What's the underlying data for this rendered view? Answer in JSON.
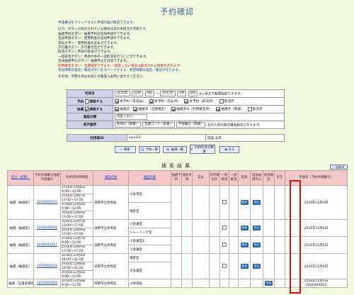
{
  "page": {
    "title": "予約確認"
  },
  "notice": {
    "lead": "申請番号をクリックすると申請内容が確認できます。",
    "lines": [
      "以下、ボタンが表示されている場合は次の手続きが可能です。",
      "抽選予約ボタン：抽選予約の追加申請ができます。",
      "追加申請ボタン：使用料金の追加申請ができます。",
      "支払ボタン：使用料金の支払ができます。",
      "許可書ボタン：許可書が出力できます。",
      "取消ボタン：申請の取消ができます。",
      "一括取消ボタン：申請の中の一括取消を行うことができます。",
      "追加抽選申込ボタン：抽選申込を追加できます。",
      "利用確定ボタン：当選確定できます。（確定しない場合は取消される場合があります）",
      "有効時間の設定／確認ボタンをクリックすると、希望時間の設定／確認が行えます。"
    ],
    "contact": "その他、不明な点はお近くの施設へお問い合わせください。"
  },
  "search": {
    "date_label": "利用日",
    "from_year": "2016年",
    "from_month": "12月",
    "from_day": "6日",
    "tilde": "～",
    "to_year": "2017年",
    "to_month": "6月",
    "to_day": "5日",
    "range_note": "6ヶ月まで期間指定できます。",
    "reserve_label": "予約",
    "reserve_check": "検索する",
    "reserve_opts": [
      "本予約（未支払）",
      "本予約（支払済）",
      "本予約（取消済）",
      "取消済"
    ],
    "lottery_label": "抽選",
    "lottery_check": "検索する",
    "lottery_opts": [
      "抽選前",
      "抽選済（当選確定）",
      "抽選済み（利用確定済）",
      "抽選済（落選）",
      "取消済"
    ],
    "facility_label": "施設分類",
    "facility_value": "指定しない",
    "sort_label": "表示順序",
    "sort1": "利用日（昇順）",
    "sort2": "当選コード（昇順）",
    "sort3": "申請番号（昇順）",
    "sort_note": "左から表示順の優先順位となります。"
  },
  "user": {
    "id_label": "利用者ID",
    "id_value": "kojin01",
    "name_value": "施設 太郎"
  },
  "buttons": {
    "search": "検索",
    "reserve_list": "予約一覧",
    "lottery_list": "抽選一覧",
    "fee_settle": "利用料金の精算",
    "back": "戻る",
    "batch_cancel": "一括取消"
  },
  "list": {
    "title": "検索結果",
    "headers": [
      "区分（状態）",
      "予約申請番号抽選申請番号",
      "利用日利用時間",
      "施設名称",
      "施設名称",
      "抽選予約",
      "減免申請",
      "支払",
      "許可書出力",
      "一括取消",
      "一部取消",
      "取消",
      "追加抽選申込",
      "利用確定",
      "許可",
      "申請日（予約申請番号）"
    ],
    "rows": [
      {
        "kind": "抽選（抽選前）",
        "no": "2016000015",
        "date": "2016年12月6日",
        "time": "9:00～12:00",
        "date2": "2016年12月7日",
        "time2": "13:00～17:00",
        "date3": "2016年12月8日",
        "time3": "9:00～12:00",
        "date4": "2016年12月9日",
        "time4": "13:00～17:00",
        "facility": "日野市立体育館",
        "room": "小体育館",
        "room2": "更衣室",
        "action": "取消",
        "action2": "申込",
        "applied": "2016年12月6日"
      },
      {
        "kind": "抽選（抽選前）",
        "no": "2016000016",
        "date": "2016年12月7日",
        "time": "13:00～17:00",
        "date2": "2016年12月8日",
        "time2": "13:00～17:00",
        "facility": "日野市立体育館",
        "room": "小会議室",
        "room2": "トレーニング室",
        "action": "取消",
        "action2": "申込",
        "applied": "2016年12月6日"
      },
      {
        "kind": "抽選（抽選前）",
        "no": "2016000017",
        "date": "2016年12月7日",
        "time": "9:00～12:00",
        "date2": "2016年12月9日",
        "time2": "13:00～17:00",
        "facility": "日野市立体育館",
        "room": "小会議室2",
        "room2": "小会議室",
        "action": "取消",
        "action2": "申込",
        "applied": "2016年12月6日"
      },
      {
        "kind": "抽選（抽選前）",
        "no": "2016000018",
        "date": "2016年12月8日",
        "time": "18:00～21:00",
        "date2": "2016年12月8日",
        "time2": "18:00～21:00",
        "date3": "2016年12月8日",
        "time3": "9:00～12:00",
        "facility": "日野市立体育館",
        "room": "更衣室",
        "room2": "大会議室",
        "action": "取消",
        "action2": "申込",
        "applied": "2016年12月6日"
      },
      {
        "kind": "抽選（当選未確定）",
        "no": "2016000023",
        "date": "2016年12月8日",
        "time": "9:00～12:00",
        "facility": "日野市立体育館",
        "room": "小体育館",
        "action": "利用",
        "applied": "2016年12月6日",
        "applied2": "（2016000023）"
      }
    ]
  }
}
